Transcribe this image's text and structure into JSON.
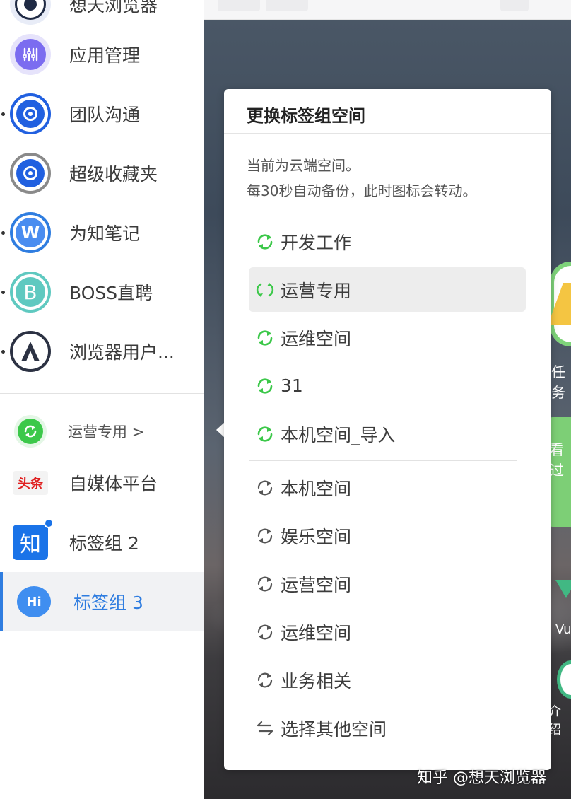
{
  "sidebar": {
    "items": [
      {
        "label": "想天浏览器"
      },
      {
        "label": "应用管理"
      },
      {
        "label": "团队沟通"
      },
      {
        "label": "超级收藏夹"
      },
      {
        "label": "为知笔记"
      },
      {
        "label": "BOSS直聘"
      },
      {
        "label": "浏览器用户..."
      }
    ],
    "workspace_switch": {
      "label": "运营专用 >"
    },
    "groups": [
      {
        "label": "自媒体平台",
        "icon_text": "头条"
      },
      {
        "label": "标签组 2",
        "icon_text": "知"
      },
      {
        "label": "标签组 3",
        "icon_text": "Hi",
        "active": true
      }
    ]
  },
  "popup": {
    "title": "更换标签组空间",
    "desc_line1": "当前为云端空间。",
    "desc_line2": "每30秒自动备份，此时图标会转动。",
    "cloud_spaces": [
      "开发工作",
      "运营专用",
      "运维空间",
      "31",
      "本机空间_导入"
    ],
    "local_spaces": [
      "本机空间",
      "娱乐空间",
      "运营空间",
      "运维空间",
      "业务相关"
    ],
    "other": "选择其他空间"
  },
  "background": {
    "app_label_1": "任务",
    "app_label_2": "看过",
    "app_label_3": "Vu",
    "app_label_4": "介绍"
  },
  "watermark": "知乎 @想天浏览器",
  "colors": {
    "accent": "#2f7de0",
    "sync_green": "#3cc84a",
    "icon_gray": "#555555"
  }
}
